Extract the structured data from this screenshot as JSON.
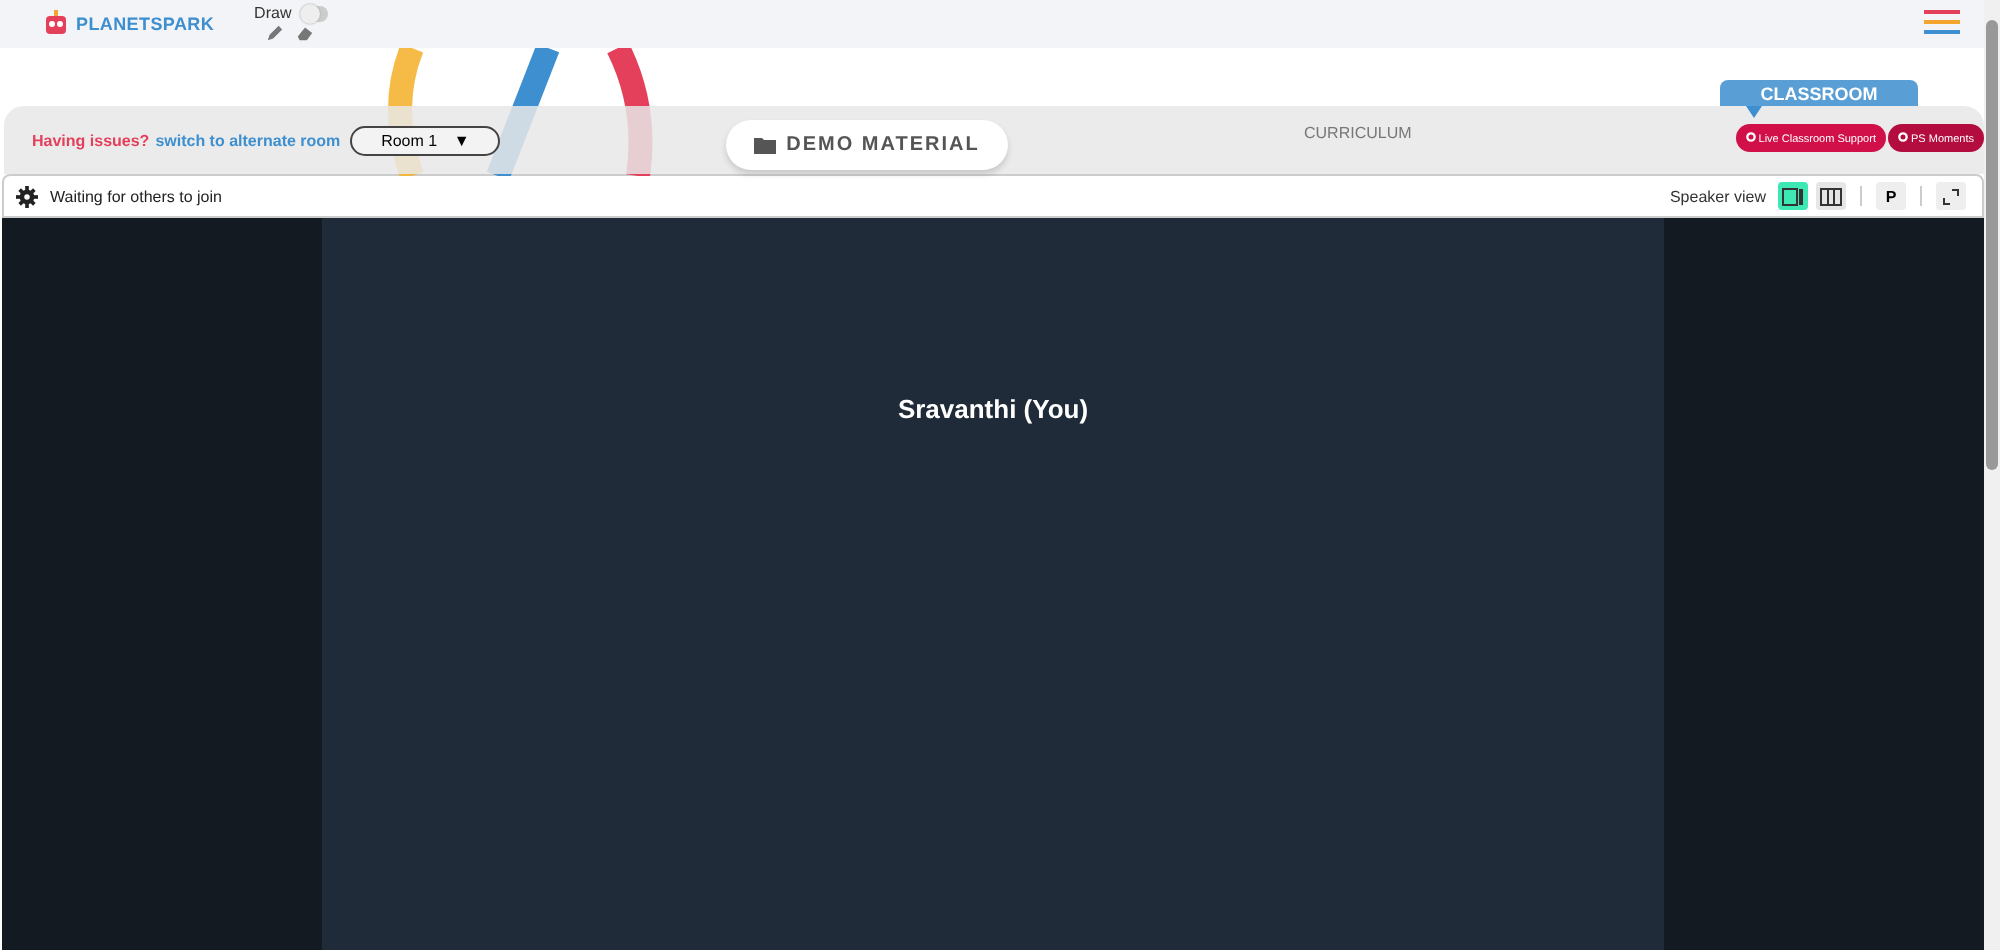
{
  "header": {
    "logo": "PLANETSPARK",
    "draw": {
      "label": "Draw",
      "on": false
    }
  },
  "room_bar": {
    "issue": "Having issues?",
    "switch_link": "switch to alternate room",
    "room": "Room 1",
    "room_caret": "▼"
  },
  "tabs": [
    {
      "label": "DEMO MATERIAL",
      "selected": true
    },
    {
      "label": "CURRICULUM",
      "selected": false
    },
    {
      "label": "CLASSROOM",
      "selected": false
    }
  ],
  "support_buttons": [
    "Live Classroom Support",
    "PS Moments"
  ],
  "toolbar": {
    "status": "Waiting for others to join",
    "view_label": "Speaker view",
    "views": [
      {
        "kind": "speaker",
        "selected": true
      },
      {
        "kind": "grid",
        "selected": false
      }
    ],
    "p_button": "P"
  },
  "video": {
    "participant": "Sravanthi (You)"
  }
}
